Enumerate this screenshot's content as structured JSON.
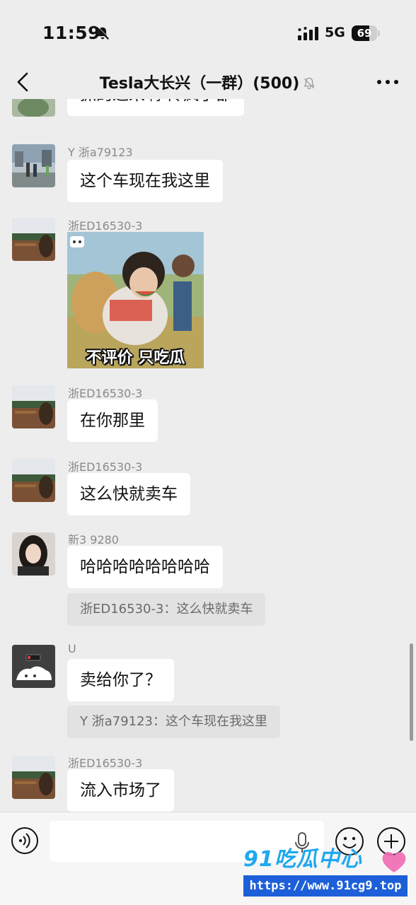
{
  "status_bar": {
    "time": "11:59",
    "network": "5G",
    "battery_level": "69",
    "battery_fraction": 0.69,
    "icons": [
      "bell-mute-icon",
      "signal-bars-icon"
    ]
  },
  "header": {
    "title": "Tesla大长兴（一群）(500)",
    "icons": [
      "back-arrow-icon",
      "bell-mute-icon",
      "more-dots-icon"
    ]
  },
  "messages": [
    {
      "sender": "",
      "text": "抓的过来啊 传疯了都",
      "partial": true
    },
    {
      "sender": "Y 浙a79123",
      "text": "这个车现在我这里"
    },
    {
      "sender": "浙ED16530-3",
      "sticker_caption": "不评价 只吃瓜"
    },
    {
      "sender": "浙ED16530-3",
      "text": "在你那里"
    },
    {
      "sender": "浙ED16530-3",
      "text": "这么快就卖车"
    },
    {
      "sender": "新3 9280",
      "text": "哈哈哈哈哈哈哈哈",
      "quote": "浙ED16530-3：这么快就卖车"
    },
    {
      "sender": "U",
      "text": "卖给你了？",
      "quote": "Y 浙a79123：这个车现在我这里"
    },
    {
      "sender": "浙ED16530-3",
      "text": "流入市场了"
    }
  ],
  "input_bar": {
    "placeholder": "",
    "icons": [
      "voice-icon",
      "microphone-icon",
      "emoji-icon",
      "add-icon"
    ]
  },
  "watermark": {
    "logo": "91吃瓜中心",
    "url": "https://www.91cg9.top"
  },
  "colors": {
    "background": "#ededed",
    "bubble": "#ffffff",
    "quote": "#e2e2e2",
    "watermark_blue": "#1c5fd8"
  }
}
